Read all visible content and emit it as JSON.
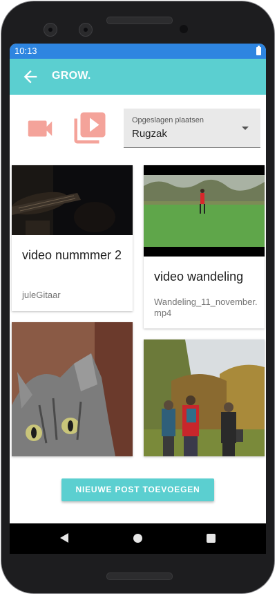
{
  "status": {
    "time": "10:13"
  },
  "appbar": {
    "title": "GROW."
  },
  "icons": {
    "back": "arrow-left-icon",
    "record": "video-camera-icon",
    "library": "video-library-icon"
  },
  "colors": {
    "accent": "#5bcfd0",
    "statusbar": "#2e85e0",
    "icon_salmon": "#f4a39a"
  },
  "select": {
    "label": "Opgeslagen plaatsen",
    "value": "Rugzak"
  },
  "cards": [
    {
      "title": "video nummmer 2",
      "subtitle": "juleGitaar",
      "thumbnail": "dark guitar scene"
    },
    {
      "title": "video wandeling",
      "subtitle": "Wandeling_11_november.mp4",
      "thumbnail": "person on grass field"
    },
    {
      "title": "",
      "subtitle": "",
      "thumbnail": "tabby cat close-up"
    },
    {
      "title": "",
      "subtitle": "",
      "thumbnail": "group hiking in autumn forest"
    }
  ],
  "add_button": {
    "label": "NIEUWE POST TOEVOEGEN"
  }
}
